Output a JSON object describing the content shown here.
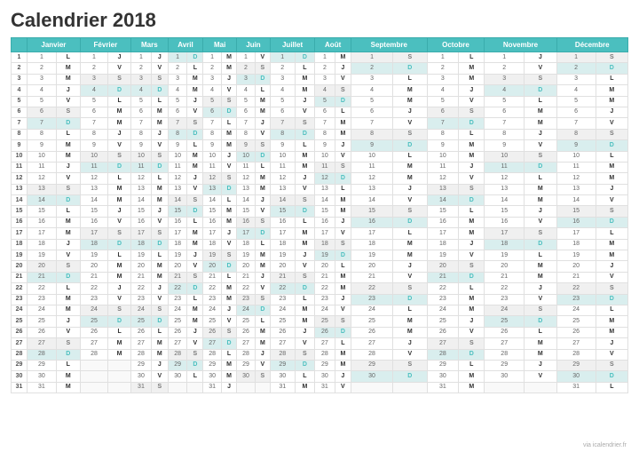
{
  "title": "Calendrier 2018",
  "months": [
    "Janvier",
    "Février",
    "Mars",
    "Avril",
    "Mai",
    "Juin",
    "Juillet",
    "Août",
    "Septembre",
    "Octobre",
    "Novembre",
    "Décembre"
  ],
  "watermark": "via icalendrier.fr",
  "days": {
    "2018": {
      "Jan": [
        "L",
        "M",
        "M",
        "J",
        "V",
        "S",
        "D",
        "L",
        "M",
        "M",
        "J",
        "V",
        "S",
        "D",
        "L",
        "M",
        "M",
        "J",
        "V",
        "S",
        "D",
        "L",
        "M",
        "M",
        "J",
        "V",
        "S",
        "D",
        "L",
        "M",
        "M"
      ],
      "Feb": [
        "J",
        "V",
        "S",
        "D",
        "L",
        "M",
        "M",
        "J",
        "V",
        "S",
        "D",
        "L",
        "M",
        "M",
        "J",
        "V",
        "S",
        "D",
        "L",
        "M",
        "M",
        "J",
        "V",
        "S",
        "D",
        "L",
        "M",
        "M",
        "",
        "",
        ""
      ],
      "Mar": [
        "J",
        "V",
        "S",
        "D",
        "L",
        "M",
        "M",
        "J",
        "V",
        "S",
        "D",
        "L",
        "M",
        "M",
        "J",
        "V",
        "S",
        "D",
        "L",
        "M",
        "M",
        "J",
        "V",
        "S",
        "D",
        "L",
        "M",
        "M",
        "J",
        "V",
        "S"
      ],
      "Apr": [
        "D",
        "L",
        "M",
        "M",
        "J",
        "V",
        "S",
        "D",
        "L",
        "M",
        "M",
        "J",
        "V",
        "S",
        "D",
        "L",
        "M",
        "M",
        "J",
        "V",
        "S",
        "D",
        "L",
        "M",
        "M",
        "J",
        "V",
        "S",
        "D",
        "L",
        ""
      ],
      "May": [
        "M",
        "M",
        "J",
        "V",
        "S",
        "D",
        "L",
        "M",
        "M",
        "J",
        "V",
        "S",
        "D",
        "L",
        "M",
        "M",
        "J",
        "V",
        "S",
        "D",
        "L",
        "M",
        "M",
        "J",
        "V",
        "S",
        "D",
        "L",
        "M",
        "M",
        "J"
      ],
      "Jun": [
        "V",
        "S",
        "D",
        "L",
        "M",
        "M",
        "J",
        "V",
        "S",
        "D",
        "L",
        "M",
        "M",
        "J",
        "V",
        "S",
        "D",
        "L",
        "M",
        "M",
        "J",
        "V",
        "S",
        "D",
        "L",
        "M",
        "M",
        "J",
        "V",
        "S",
        ""
      ],
      "Jul": [
        "D",
        "L",
        "M",
        "M",
        "J",
        "V",
        "S",
        "D",
        "L",
        "M",
        "M",
        "J",
        "V",
        "S",
        "D",
        "L",
        "M",
        "M",
        "J",
        "V",
        "S",
        "D",
        "L",
        "M",
        "M",
        "J",
        "V",
        "S",
        "D",
        "L",
        "M"
      ],
      "Aug": [
        "M",
        "J",
        "V",
        "S",
        "D",
        "L",
        "M",
        "M",
        "J",
        "V",
        "S",
        "D",
        "L",
        "M",
        "M",
        "J",
        "V",
        "S",
        "D",
        "L",
        "M",
        "M",
        "J",
        "V",
        "S",
        "D",
        "L",
        "M",
        "M",
        "J",
        "V"
      ],
      "Sep": [
        "S",
        "D",
        "L",
        "M",
        "M",
        "J",
        "V",
        "S",
        "D",
        "L",
        "M",
        "M",
        "J",
        "V",
        "S",
        "D",
        "L",
        "M",
        "M",
        "J",
        "V",
        "S",
        "D",
        "L",
        "M",
        "M",
        "J",
        "V",
        "S",
        "D",
        ""
      ],
      "Oct": [
        "L",
        "M",
        "M",
        "J",
        "V",
        "S",
        "D",
        "L",
        "M",
        "M",
        "J",
        "V",
        "S",
        "D",
        "L",
        "M",
        "M",
        "J",
        "V",
        "S",
        "D",
        "L",
        "M",
        "M",
        "J",
        "V",
        "S",
        "D",
        "L",
        "M",
        "M"
      ],
      "Nov": [
        "J",
        "V",
        "S",
        "D",
        "L",
        "M",
        "M",
        "J",
        "V",
        "S",
        "D",
        "L",
        "M",
        "M",
        "J",
        "V",
        "S",
        "D",
        "L",
        "M",
        "M",
        "J",
        "V",
        "S",
        "D",
        "L",
        "M",
        "M",
        "J",
        "V",
        ""
      ],
      "Dec": [
        "S",
        "D",
        "L",
        "M",
        "M",
        "J",
        "V",
        "S",
        "D",
        "L",
        "M",
        "M",
        "J",
        "V",
        "S",
        "D",
        "L",
        "M",
        "M",
        "J",
        "V",
        "S",
        "D",
        "L",
        "M",
        "M",
        "J",
        "V",
        "S",
        "D",
        "L"
      ]
    }
  }
}
